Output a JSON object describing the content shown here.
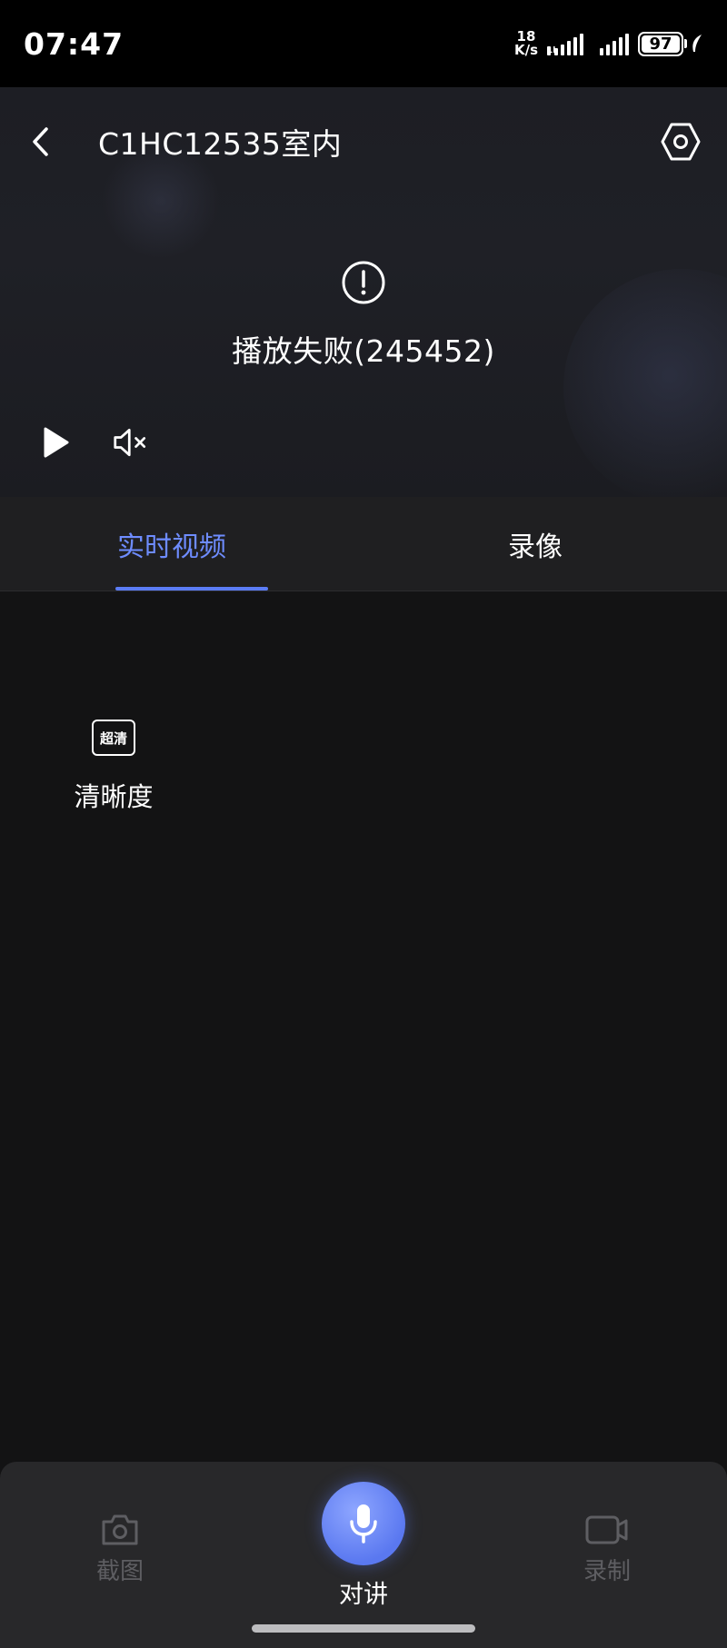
{
  "status_bar": {
    "time": "07:47",
    "net_speed_value": "18",
    "net_speed_unit": "K/s",
    "signal1_tag": "1l",
    "battery_level": "97"
  },
  "header": {
    "title": "C1HC12535室内"
  },
  "player": {
    "error_text": "播放失败(245452)"
  },
  "tabs": [
    {
      "label": "实时视频",
      "active": true
    },
    {
      "label": "录像",
      "active": false
    }
  ],
  "content": {
    "clarity_badge": "超清",
    "clarity_label": "清晰度"
  },
  "bottom_bar": {
    "screenshot_label": "截图",
    "talk_label": "对讲",
    "record_label": "录制"
  },
  "colors": {
    "accent": "#5b7cf6",
    "tab_active_text": "#6e8cff",
    "background": "#131314",
    "bottom_bar": "#28282a",
    "disabled_text": "#5e5e62"
  }
}
